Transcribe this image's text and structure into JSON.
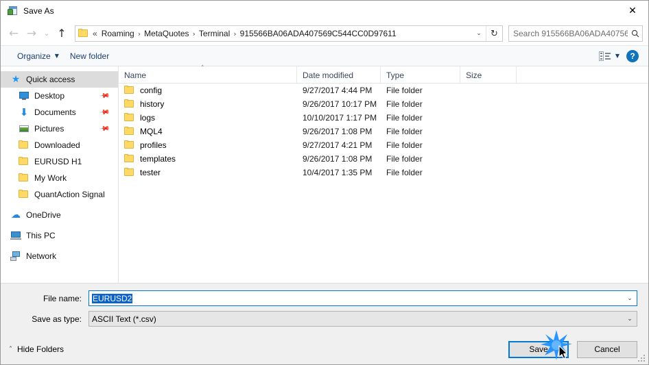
{
  "window": {
    "title": "Save As",
    "icon": "save-as-app-icon",
    "close_label": "✕"
  },
  "nav": {
    "back_icon": "arrow-left-icon",
    "back_glyph": "←",
    "forward_icon": "arrow-right-icon",
    "forward_glyph": "→",
    "recent_icon": "chevron-down-icon",
    "recent_glyph": "∨",
    "up_icon": "arrow-up-icon",
    "up_glyph": "↑",
    "address": {
      "folder_icon": "folder-icon",
      "overflow": "«",
      "separator": "›",
      "crumbs": [
        "Roaming",
        "MetaQuotes",
        "Terminal",
        "915566BA06ADA407569C544CC0D97611"
      ],
      "dropdown_glyph": "∨",
      "refresh_glyph": "↻",
      "refresh_icon": "refresh-icon"
    },
    "search": {
      "placeholder": "Search 915566BA06ADA40756...",
      "value": "",
      "icon": "search-icon",
      "icon_glyph": "⚲"
    }
  },
  "toolbar": {
    "organize_label": "Organize",
    "organize_caret": "▼",
    "new_folder_label": "New folder",
    "view_icon": "view-options-icon",
    "view_caret": "▼",
    "help_icon": "help-icon",
    "help_label": "?"
  },
  "sidebar": {
    "items": [
      {
        "label": "Quick access",
        "icon": "star-icon",
        "selected": true,
        "pinned": false,
        "indent": false,
        "group": false
      },
      {
        "label": "Desktop",
        "icon": "desktop-icon",
        "selected": false,
        "pinned": true,
        "indent": true,
        "group": false
      },
      {
        "label": "Documents",
        "icon": "documents-icon",
        "selected": false,
        "pinned": true,
        "indent": true,
        "group": false
      },
      {
        "label": "Pictures",
        "icon": "pictures-icon",
        "selected": false,
        "pinned": true,
        "indent": true,
        "group": false
      },
      {
        "label": "Downloaded",
        "icon": "folder-icon",
        "selected": false,
        "pinned": false,
        "indent": true,
        "group": false
      },
      {
        "label": "EURUSD H1",
        "icon": "folder-icon",
        "selected": false,
        "pinned": false,
        "indent": true,
        "group": false
      },
      {
        "label": "My Work",
        "icon": "folder-icon",
        "selected": false,
        "pinned": false,
        "indent": true,
        "group": false
      },
      {
        "label": "QuantAction Signal",
        "icon": "folder-icon",
        "selected": false,
        "pinned": false,
        "indent": true,
        "group": false
      },
      {
        "label": "OneDrive",
        "icon": "onedrive-cloud-icon",
        "selected": false,
        "pinned": false,
        "indent": false,
        "group": true
      },
      {
        "label": "This PC",
        "icon": "this-pc-icon",
        "selected": false,
        "pinned": false,
        "indent": false,
        "group": true
      },
      {
        "label": "Network",
        "icon": "network-icon",
        "selected": false,
        "pinned": false,
        "indent": false,
        "group": true
      }
    ],
    "pin_glyph": "✐"
  },
  "filelist": {
    "columns": [
      {
        "label": "Name",
        "sorted": true,
        "sort_caret": "˄"
      },
      {
        "label": "Date modified",
        "sorted": false
      },
      {
        "label": "Type",
        "sorted": false
      },
      {
        "label": "Size",
        "sorted": false
      }
    ],
    "rows": [
      {
        "name": "config",
        "date": "9/27/2017 4:44 PM",
        "type": "File folder",
        "size": "",
        "icon": "folder-icon"
      },
      {
        "name": "history",
        "date": "9/26/2017 10:17 PM",
        "type": "File folder",
        "size": "",
        "icon": "folder-icon"
      },
      {
        "name": "logs",
        "date": "10/10/2017 1:17 PM",
        "type": "File folder",
        "size": "",
        "icon": "folder-icon"
      },
      {
        "name": "MQL4",
        "date": "9/26/2017 1:08 PM",
        "type": "File folder",
        "size": "",
        "icon": "folder-icon"
      },
      {
        "name": "profiles",
        "date": "9/27/2017 4:21 PM",
        "type": "File folder",
        "size": "",
        "icon": "folder-icon"
      },
      {
        "name": "templates",
        "date": "9/26/2017 1:08 PM",
        "type": "File folder",
        "size": "",
        "icon": "folder-icon"
      },
      {
        "name": "tester",
        "date": "10/4/2017 1:35 PM",
        "type": "File folder",
        "size": "",
        "icon": "folder-icon"
      }
    ]
  },
  "form": {
    "filename_label": "File name:",
    "filename_value": "EURUSD2",
    "filename_selected": true,
    "filetype_label": "Save as type:",
    "filetype_value": "ASCII Text (*.csv)",
    "dropdown_glyph": "∨"
  },
  "footer": {
    "hide_folders_label": "Hide Folders",
    "hide_folders_caret": "˄",
    "save_label": "Save",
    "cancel_label": "Cancel"
  },
  "colors": {
    "accent": "#0078d7",
    "selection_text": "#0a63c9",
    "sidebar_selected": "#dcdcdc",
    "folder_yellow": "#ffd966",
    "help_blue": "#1074bc",
    "toolbar_link": "#1c3f73"
  }
}
